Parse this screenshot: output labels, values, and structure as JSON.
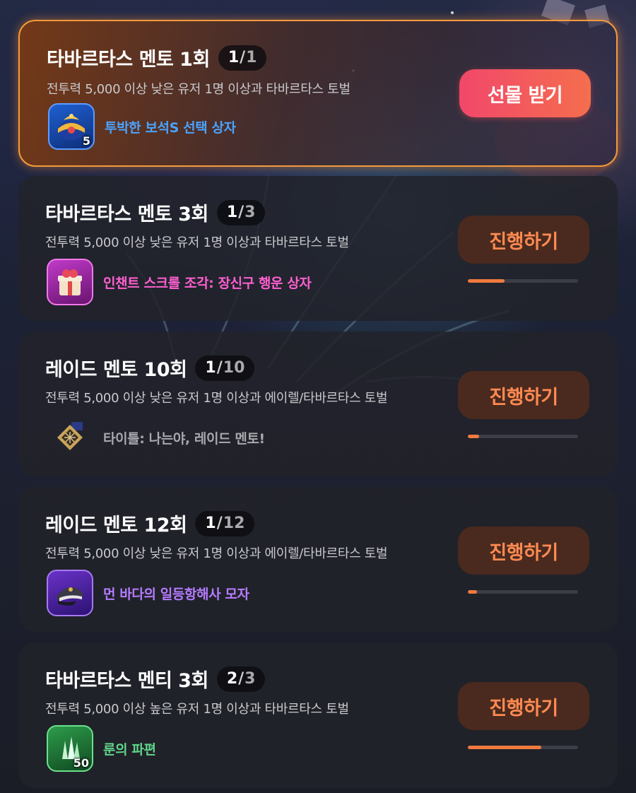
{
  "missions": [
    {
      "title": "타바르타스 멘토 1회",
      "current": "1",
      "total": "1",
      "description": "전투력 5,000 이상 낮은 유저 1명 이상과 타바르타스 토벌",
      "reward_name": "투박한 보석S 선택 상자",
      "reward_icon": "gem-box-icon",
      "reward_count": "5",
      "reward_color": "#4aa3ff",
      "button_label": "선물 받기",
      "state": "claimable",
      "progress_fraction": 1.0
    },
    {
      "title": "타바르타스 멘토 3회",
      "current": "1",
      "total": "3",
      "description": "전투력 5,000 이상 낮은 유저 1명 이상과 타바르타스 토벌",
      "reward_name": "인챈트 스크롤 조각: 장신구 행운 상자",
      "reward_icon": "gift-box-icon",
      "reward_count": "",
      "reward_color": "#ff5fd0",
      "button_label": "진행하기",
      "state": "in_progress",
      "progress_fraction": 0.333
    },
    {
      "title": "레이드 멘토 10회",
      "current": "1",
      "total": "10",
      "description": "전투력 5,000 이상 낮은 유저 1명 이상과 에이렐/타바르타스 토벌",
      "reward_name": "타이틀: 나는야, 레이드 멘토!",
      "reward_icon": "title-badge-icon",
      "reward_count": "",
      "reward_color": "#a8a8ae",
      "button_label": "진행하기",
      "state": "in_progress",
      "progress_fraction": 0.1
    },
    {
      "title": "레이드 멘토 12회",
      "current": "1",
      "total": "12",
      "description": "전투력 5,000 이상 낮은 유저 1명 이상과 에이렐/타바르타스 토벌",
      "reward_name": "먼 바다의 일등항해사 모자",
      "reward_icon": "captain-hat-icon",
      "reward_count": "",
      "reward_color": "#b57cff",
      "button_label": "진행하기",
      "state": "in_progress",
      "progress_fraction": 0.083
    },
    {
      "title": "타바르타스 멘티 3회",
      "current": "2",
      "total": "3",
      "description": "전투력 5,000 이상 높은 유저 1명 이상과 타바르타스 토벌",
      "reward_name": "룬의 파편",
      "reward_icon": "rune-shard-icon",
      "reward_count": "50",
      "reward_color": "#5fd48a",
      "button_label": "진행하기",
      "state": "in_progress",
      "progress_fraction": 0.667
    }
  ]
}
